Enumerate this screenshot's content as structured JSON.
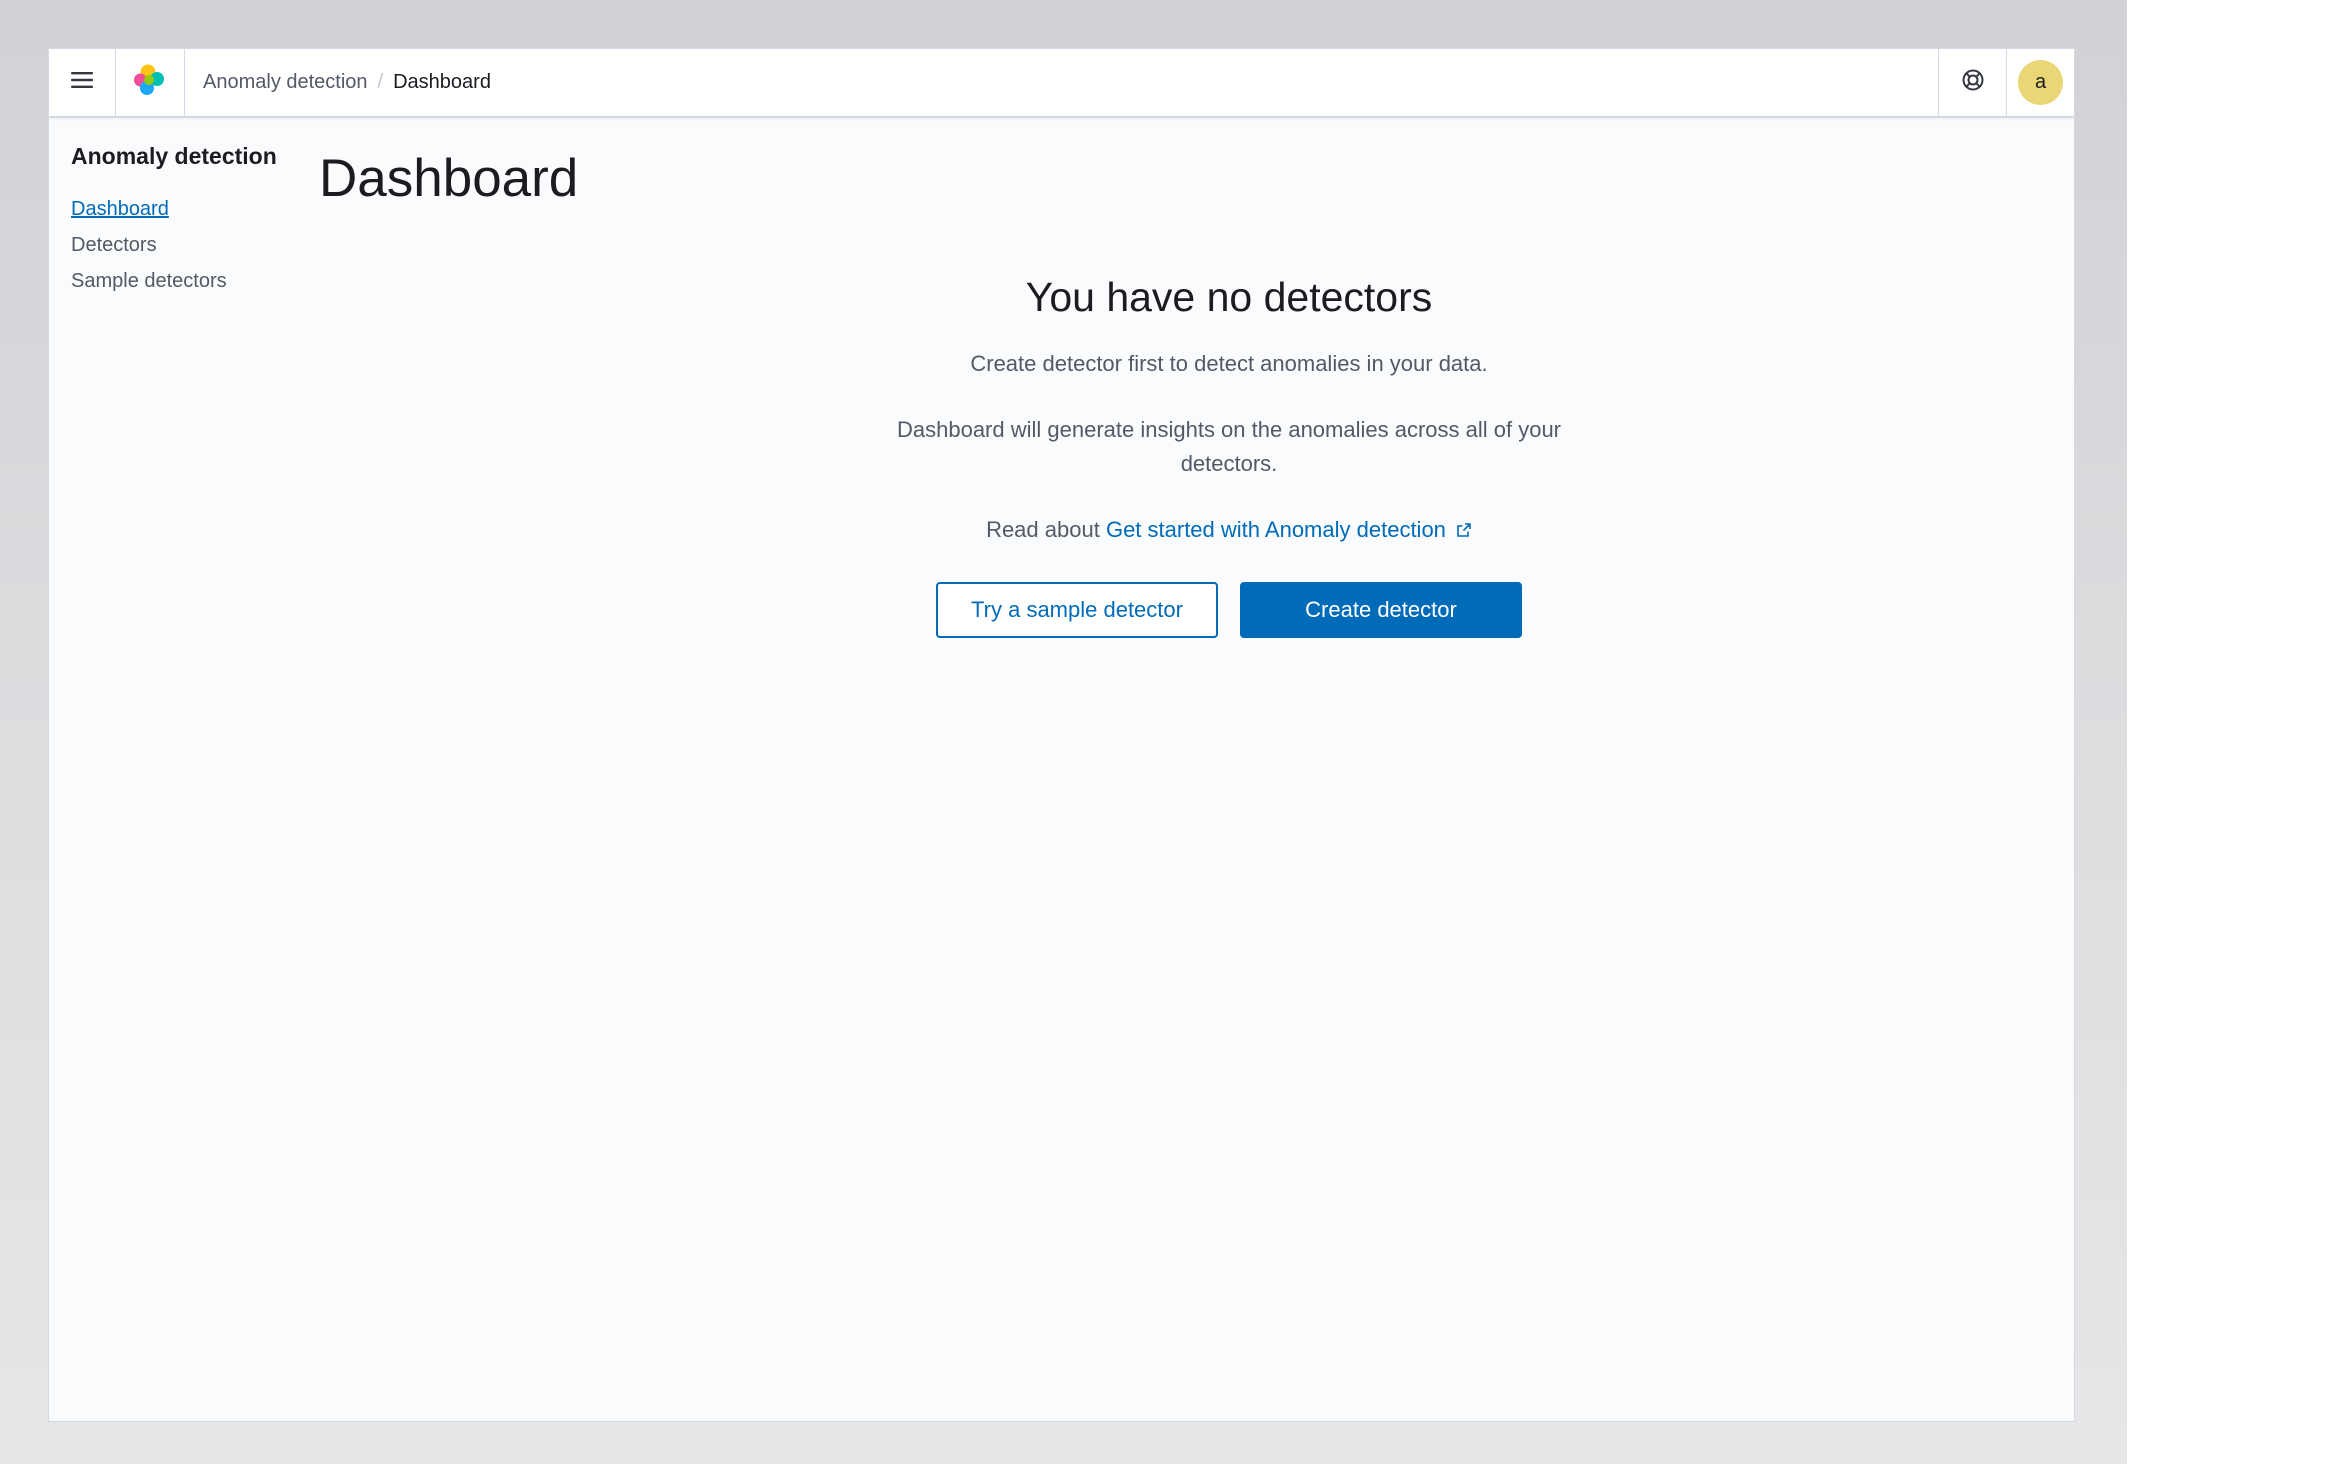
{
  "header": {
    "menu_icon": "hamburger-menu-icon",
    "logo_icon": "app-logo-icon",
    "breadcrumbs": [
      "Anomaly detection",
      "Dashboard"
    ],
    "help_icon": "help-lifebuoy-icon",
    "avatar_initial": "a",
    "avatar_color": "#ead675"
  },
  "sidenav": {
    "title": "Anomaly detection",
    "items": [
      {
        "label": "Dashboard",
        "active": true
      },
      {
        "label": "Detectors",
        "active": false
      },
      {
        "label": "Sample detectors",
        "active": false
      }
    ]
  },
  "main": {
    "page_title": "Dashboard",
    "empty_title": "You have no detectors",
    "empty_line1": "Create detector first to detect anomalies in your data.",
    "empty_line2": "Dashboard will generate insights on the anomalies across all of your detectors.",
    "read_about_prefix": "Read about",
    "read_about_link": "Get started with Anomaly detection",
    "external_link_icon": "external-link-icon",
    "secondary_button": "Try a sample detector",
    "primary_button": "Create detector"
  },
  "colors": {
    "accent": "#006bb8",
    "text": "#1a1c21",
    "subdued_text": "#535966",
    "border": "#d3dae6",
    "page_bg": "#fafbfd"
  }
}
